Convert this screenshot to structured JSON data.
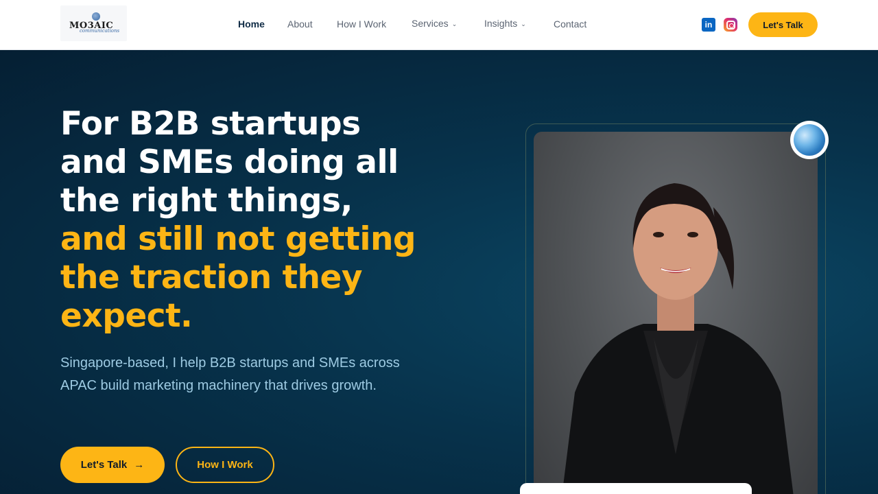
{
  "header": {
    "logo": {
      "text": "MO3AIC",
      "subtext": "communications"
    },
    "nav": [
      {
        "label": "Home",
        "active": true
      },
      {
        "label": "About",
        "active": false
      },
      {
        "label": "How I Work",
        "active": false
      },
      {
        "label": "Services",
        "active": false,
        "dropdown": true
      },
      {
        "label": "Insights",
        "active": false,
        "dropdown": true
      },
      {
        "label": "Contact",
        "active": false
      }
    ],
    "social": {
      "linkedin_icon": "linkedin-icon",
      "linkedin_text": "in",
      "instagram_icon": "instagram-icon"
    },
    "cta_label": "Let's Talk"
  },
  "hero": {
    "headline_white": [
      "For B2B startups",
      "and SMEs doing all",
      "the right things,"
    ],
    "headline_accent": [
      "and still not getting",
      "the traction they",
      "expect."
    ],
    "subtext": "Singapore-based, I help B2B startups and SMEs across APAC build marketing machinery that drives growth.",
    "primary_button": "Let's Talk",
    "primary_arrow": "→",
    "secondary_button": "How I Work",
    "photo": "portrait-photo",
    "badge_icon": "mosaic-globe-icon"
  },
  "colors": {
    "accent": "#fdb515",
    "hero_bg": "#062a3f",
    "subtext": "#9ecbe3",
    "linkedin": "#0a66c2"
  }
}
